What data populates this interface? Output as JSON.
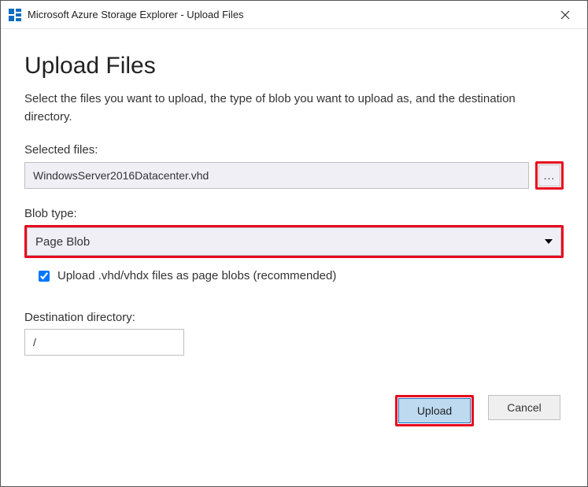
{
  "window": {
    "title": "Microsoft Azure Storage Explorer - Upload Files"
  },
  "dialog": {
    "heading": "Upload Files",
    "description": "Select the files you want to upload, the type of blob you want to upload as, and the destination directory.",
    "selectedFiles": {
      "label": "Selected files:",
      "value": "WindowsServer2016Datacenter.vhd",
      "browseLabel": "..."
    },
    "blobType": {
      "label": "Blob type:",
      "value": "Page Blob"
    },
    "vhdCheckbox": {
      "label": "Upload .vhd/vhdx files as page blobs (recommended)",
      "checked": true
    },
    "destination": {
      "label": "Destination directory:",
      "value": "/"
    },
    "buttons": {
      "upload": "Upload",
      "cancel": "Cancel"
    }
  }
}
